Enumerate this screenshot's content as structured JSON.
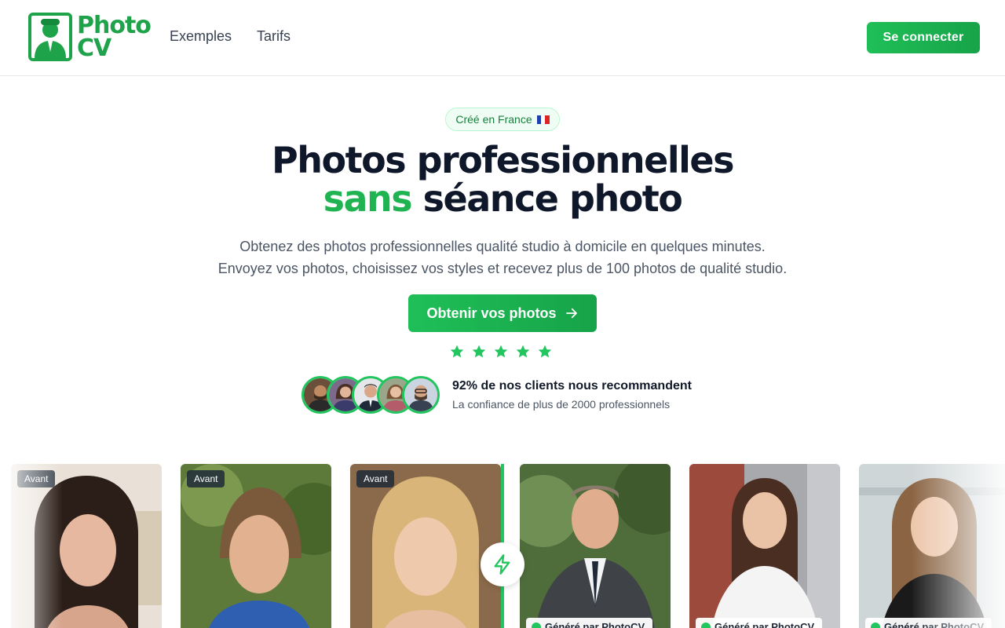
{
  "header": {
    "logo_text_line1": "Photo",
    "logo_text_line2": "CV",
    "nav": [
      {
        "label": "Exemples"
      },
      {
        "label": "Tarifs"
      }
    ],
    "login_label": "Se connecter"
  },
  "hero": {
    "badge_label": "Créé en France",
    "title_line1": "Photos professionnelles",
    "title_highlight": "sans",
    "title_line2_rest": " séance photo",
    "subtitle_line1": "Obtenez des photos professionnelles qualité studio à domicile en quelques minutes.",
    "subtitle_line2": "Envoyez vos photos, choisissez vos styles et recevez plus de 100 photos de qualité studio.",
    "cta_label": "Obtenir vos photos",
    "rating_stars": 5,
    "proof_title": "92% de nos clients nous recommandent",
    "proof_subtitle": "La confiance de plus de 2000 professionnels"
  },
  "gallery": {
    "before_label": "Avant",
    "after_label": "Généré par PhotoCV"
  },
  "colors": {
    "brand_green": "#1fb352",
    "text_dark": "#0f172a",
    "text_muted": "#4b5563"
  }
}
